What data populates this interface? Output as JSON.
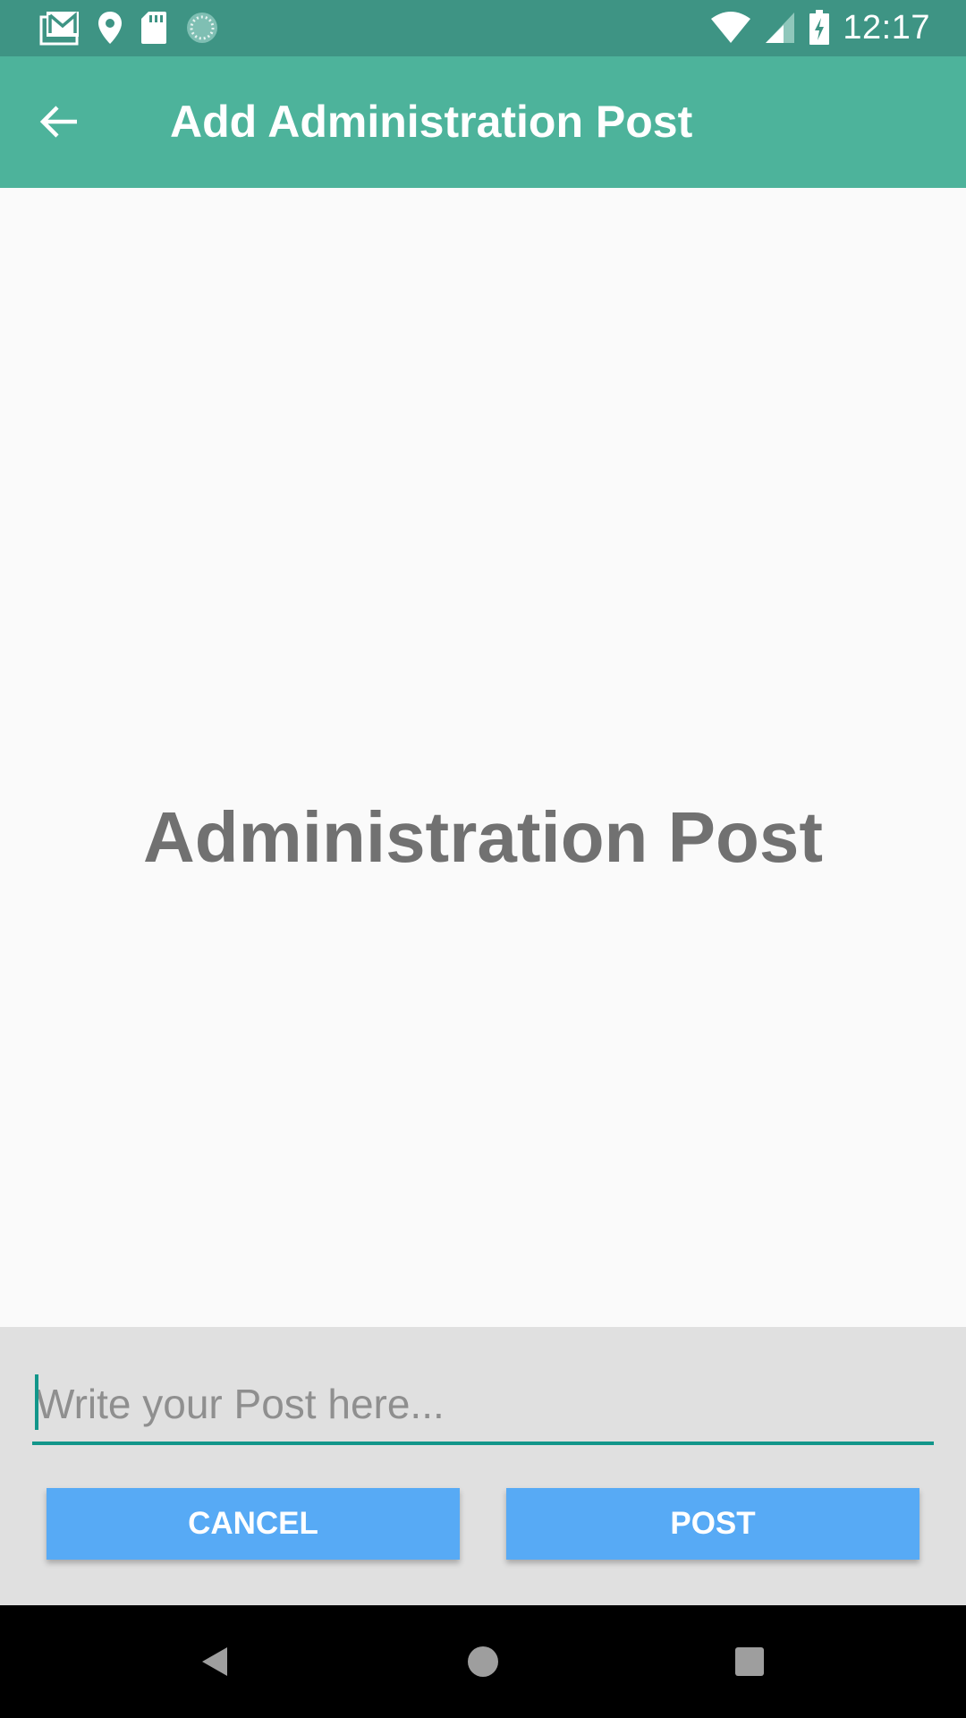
{
  "status_bar": {
    "time": "12:17",
    "left_icons": [
      "gmail-icon",
      "location-icon",
      "sd-card-icon",
      "sync-icon"
    ],
    "right_icons": [
      "wifi-icon",
      "signal-icon",
      "battery-charging-icon"
    ]
  },
  "app_bar": {
    "back_icon": "arrow-back-icon",
    "title": "Add Administration Post"
  },
  "main": {
    "heading": "Administration Post"
  },
  "composer": {
    "input_value": "",
    "input_placeholder": "Write your Post here...",
    "cancel_label": "CANCEL",
    "post_label": "POST"
  },
  "nav_bar": {
    "icons": [
      "nav-back-icon",
      "nav-home-icon",
      "nav-recents-icon"
    ]
  },
  "colors": {
    "status_bar": "#3e9484",
    "app_bar": "#4db39b",
    "accent": "#12968a",
    "button": "#57aaf5",
    "heading_text": "#717171",
    "composer_background": "#e0e0e0"
  }
}
